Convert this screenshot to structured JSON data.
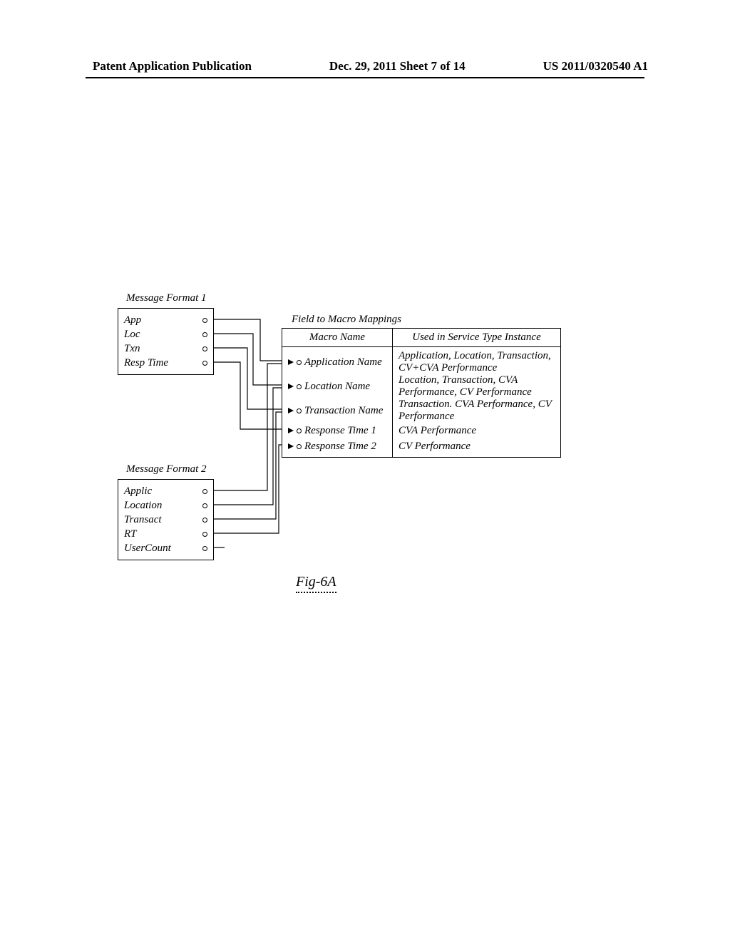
{
  "header": {
    "left": "Patent Application Publication",
    "mid": "Dec. 29, 2011  Sheet 7 of 14",
    "right": "US 2011/0320540 A1"
  },
  "figure_caption": "Fig-6A",
  "format1": {
    "title": "Message Format 1",
    "fields": [
      "App",
      "Loc",
      "Txn",
      "Resp Time"
    ]
  },
  "format2": {
    "title": "Message Format 2",
    "fields": [
      "Applic",
      "Location",
      "Transact",
      "RT",
      "UserCount"
    ]
  },
  "mappings": {
    "title": "Field to Macro Mappings",
    "col1": "Macro Name",
    "col2": "Used in Service Type Instance",
    "rows": [
      {
        "macro": "Application Name",
        "used": "Application, Location, Transaction, CV+CVA Performance"
      },
      {
        "macro": "Location Name",
        "used": "Location, Transaction, CVA Performance, CV Performance"
      },
      {
        "macro": "Transaction Name",
        "used": "Transaction. CVA Performance, CV Performance"
      },
      {
        "macro": "Response Time 1",
        "used": "CVA Performance"
      },
      {
        "macro": "Response Time 2",
        "used": "CV Performance"
      }
    ]
  }
}
